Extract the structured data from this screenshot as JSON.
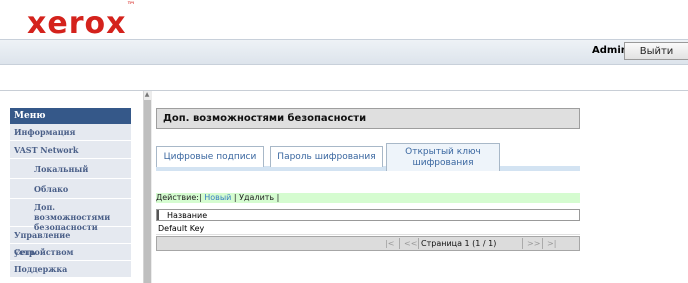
{
  "brand": {
    "logo": "xerox",
    "tm": "™",
    "color": "#d4221c"
  },
  "header": {
    "user": "Admin",
    "logout_label": "Выйти"
  },
  "sidebar": {
    "title": "Меню",
    "items": [
      {
        "label": "Информация",
        "level": 0
      },
      {
        "label": "VAST Network",
        "level": 0
      },
      {
        "label": "Локальный",
        "level": 1
      },
      {
        "label": "Облако",
        "level": 1
      },
      {
        "label": "Доп. возможностями безопасности",
        "level": 1
      },
      {
        "label": "Управление устройством",
        "level": 0
      },
      {
        "label": "Сеть",
        "level": 0
      },
      {
        "label": "Поддержка",
        "level": 0
      }
    ]
  },
  "main": {
    "title": "Доп. возможностями безопасности",
    "tabs": [
      {
        "label": "Цифровые подписи",
        "active": false
      },
      {
        "label": "Пароль шифрования",
        "active": false
      },
      {
        "label": "Открытый ключ шифрования",
        "active": true
      }
    ],
    "actions": {
      "prefix": "Действие:",
      "new_label": "Новый",
      "delete_label": "Удалить"
    },
    "table": {
      "column_header": "Название",
      "rows": [
        "Default Key"
      ]
    },
    "pager": {
      "first": "|<",
      "prev": "<<",
      "page_text": "Страница 1 (1 / 1)",
      "next": ">>",
      "last": ">|"
    }
  }
}
